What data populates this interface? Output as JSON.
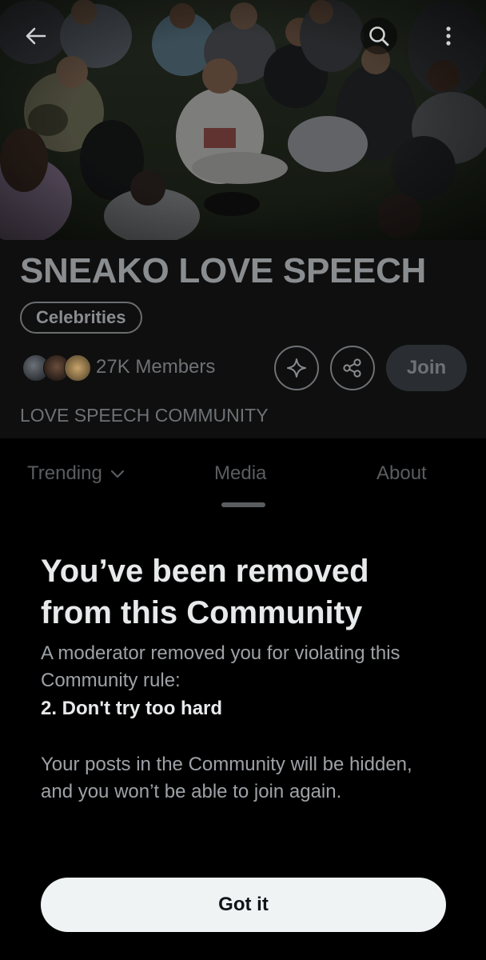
{
  "header": {
    "back_icon": "arrow-left-icon",
    "search_icon": "search-icon",
    "more_icon": "more-vertical-icon"
  },
  "community": {
    "name": "SNEAKO LOVE SPEECH",
    "category": "Celebrities",
    "members": "27K Members",
    "join_label": "Join",
    "description": "LOVE SPEECH COMMUNITY",
    "sparkle_icon": "sparkle-icon",
    "share_icon": "share-icon"
  },
  "tabs": [
    {
      "label": "Trending"
    },
    {
      "label": "Media"
    },
    {
      "label": "About"
    }
  ],
  "notice": {
    "title": "You’ve been removed from this Community",
    "body": "A moderator removed you for violating this Community rule:",
    "rule": "2. Don't try too hard",
    "note": "Your posts in the Community will be hidden, and you won’t be able to join again.",
    "button_label": "Got it"
  },
  "colors": {
    "background": "#000000",
    "panel": "#0f0f0f",
    "primary_text": "#e7e9ea",
    "button_light": "#eff3f4"
  }
}
